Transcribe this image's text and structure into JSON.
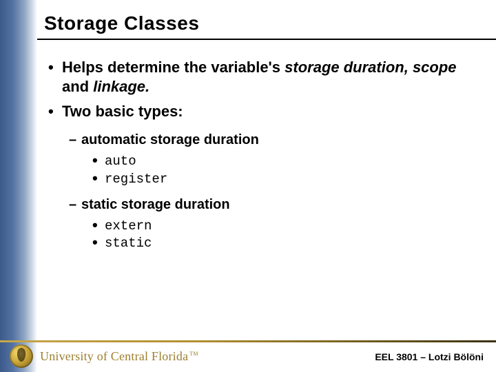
{
  "title": "Storage Classes",
  "bullets": {
    "b1": {
      "pre": "Helps determine the variable's ",
      "i1": "storage duration, scope",
      "mid": " and ",
      "i2": "linkage.",
      "post": ""
    },
    "b2": "Two basic types:",
    "sub1": {
      "label": "automatic storage duration",
      "kw1": "auto",
      "kw2": "register"
    },
    "sub2": {
      "label": "static storage duration",
      "kw1": "extern",
      "kw2": "static"
    }
  },
  "footer": {
    "university": "University of Central Florida",
    "course": "EEL 3801 – Lotzi Bölöni"
  }
}
